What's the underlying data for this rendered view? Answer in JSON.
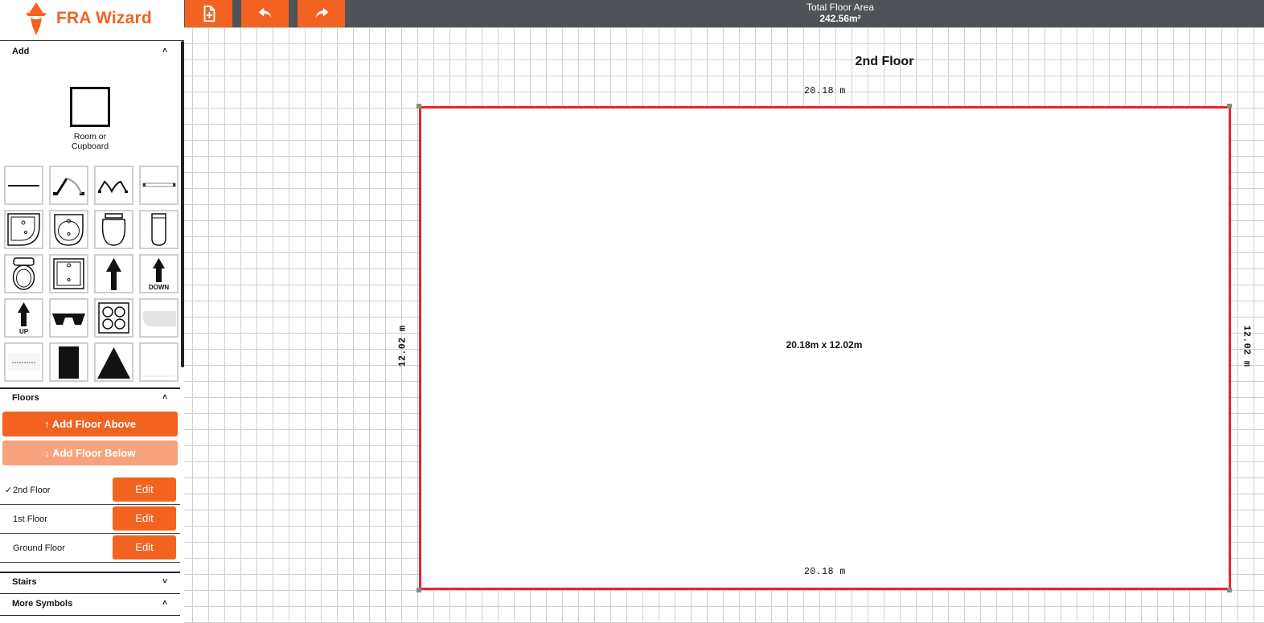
{
  "app": {
    "name": "FRA Wizard"
  },
  "toolbar": {
    "new_icon": "file-plus-icon",
    "undo_icon": "undo-icon",
    "redo_icon": "redo-icon"
  },
  "area": {
    "label": "Total Floor Area",
    "value": "242.56m²"
  },
  "sidebar": {
    "add": {
      "title": "Add",
      "room_tool": {
        "label_line1": "Room or",
        "label_line2": "Cupboard"
      },
      "symbols": [
        "wall-icon",
        "door-icon",
        "double-door-icon",
        "window-icon",
        "corner-sink-icon",
        "round-sink-icon",
        "basin-icon",
        "urinal-icon",
        "toilet-icon",
        "shower-tray-icon",
        "arrow-up-icon",
        "stairs-down-icon",
        "stairs-up-icon",
        "bench-icon",
        "hob-icon",
        "bath-icon",
        "text-label-icon",
        "rectangle-icon",
        "triangle-icon",
        "blank-icon"
      ],
      "down_caption": "DOWN",
      "up_caption": "UP"
    },
    "floors": {
      "title": "Floors",
      "add_above": "↑ Add Floor Above",
      "add_below": "↓ Add Floor Below",
      "items": [
        {
          "name": "2nd Floor",
          "selected": true,
          "edit": "Edit"
        },
        {
          "name": "1st Floor",
          "selected": false,
          "edit": "Edit"
        },
        {
          "name": "Ground Floor",
          "selected": false,
          "edit": "Edit"
        }
      ],
      "check_mark": "✓"
    },
    "stairs": {
      "title": "Stairs"
    },
    "more_symbols": {
      "title": "More Symbols"
    }
  },
  "canvas": {
    "floor_title": "2nd Floor",
    "room": {
      "size_label": "20.18m x 12.02m",
      "top_dim": "20.18 m",
      "bottom_dim": "20.18 m",
      "left_dim": "12.02 m",
      "right_dim": "12.02 m",
      "border_color": "#e8232b"
    }
  },
  "colors": {
    "accent": "#f26322",
    "accent_disabled": "#f7a37e",
    "topbar": "#4f5256"
  }
}
